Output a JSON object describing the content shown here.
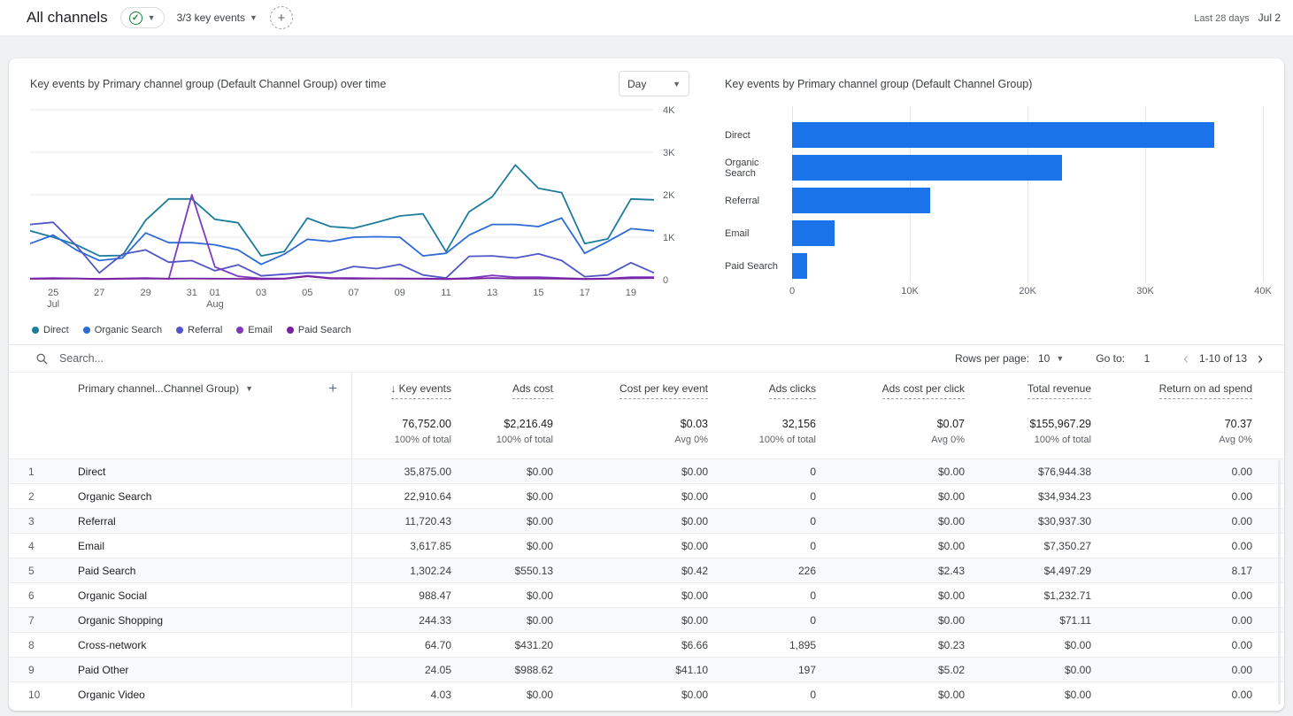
{
  "header": {
    "title": "All channels",
    "key_events_label": "3/3 key events",
    "date_range_label": "Last 28 days",
    "date_range_value": "Jul 2"
  },
  "chart_data": [
    {
      "type": "line",
      "title": "Key events by Primary channel group (Default Channel Group) over time",
      "granularity": "Day",
      "ylim": [
        0,
        4000
      ],
      "y_ticks": [
        {
          "v": 4000,
          "label": "4K"
        },
        {
          "v": 3000,
          "label": "3K"
        },
        {
          "v": 2000,
          "label": "2K"
        },
        {
          "v": 1000,
          "label": "1K"
        },
        {
          "v": 0,
          "label": "0"
        }
      ],
      "x_ticks": [
        {
          "i": 1,
          "label": "25",
          "sub": "Jul"
        },
        {
          "i": 3,
          "label": "27"
        },
        {
          "i": 5,
          "label": "29"
        },
        {
          "i": 7,
          "label": "31"
        },
        {
          "i": 8,
          "label": "01",
          "sub": "Aug"
        },
        {
          "i": 10,
          "label": "03"
        },
        {
          "i": 12,
          "label": "05"
        },
        {
          "i": 14,
          "label": "07"
        },
        {
          "i": 16,
          "label": "09"
        },
        {
          "i": 18,
          "label": "11"
        },
        {
          "i": 20,
          "label": "13"
        },
        {
          "i": 22,
          "label": "15"
        },
        {
          "i": 24,
          "label": "17"
        },
        {
          "i": 26,
          "label": "19"
        }
      ],
      "series": [
        {
          "name": "Direct",
          "color": "#1d7c9c",
          "values": [
            1150,
            1000,
            820,
            560,
            570,
            1400,
            1900,
            1900,
            1420,
            1340,
            560,
            660,
            1450,
            1250,
            1210,
            1350,
            1500,
            1550,
            660,
            1600,
            1950,
            2700,
            2150,
            2050,
            850,
            960,
            1900,
            1880
          ]
        },
        {
          "name": "Organic Search",
          "color": "#2e6bd8",
          "values": [
            850,
            1050,
            700,
            450,
            510,
            1100,
            870,
            870,
            820,
            700,
            360,
            600,
            950,
            900,
            1000,
            1010,
            1000,
            560,
            620,
            1050,
            1300,
            1300,
            1250,
            1450,
            620,
            900,
            1200,
            1150
          ]
        },
        {
          "name": "Referral",
          "color": "#5055c8",
          "values": [
            1300,
            1350,
            800,
            160,
            600,
            700,
            410,
            450,
            210,
            350,
            90,
            130,
            160,
            160,
            310,
            260,
            360,
            110,
            40,
            550,
            560,
            510,
            610,
            450,
            70,
            110,
            400,
            160
          ]
        },
        {
          "name": "Email",
          "color": "#7d3ac1",
          "values": [
            30,
            40,
            30,
            20,
            30,
            40,
            20,
            2000,
            300,
            80,
            30,
            30,
            90,
            40,
            40,
            30,
            30,
            30,
            20,
            40,
            100,
            60,
            60,
            40,
            20,
            30,
            60,
            60
          ]
        },
        {
          "name": "Paid Search",
          "color": "#7b1fa2",
          "values": [
            20,
            25,
            30,
            15,
            20,
            30,
            25,
            30,
            25,
            20,
            15,
            20,
            80,
            30,
            25,
            30,
            25,
            20,
            15,
            25,
            40,
            30,
            30,
            25,
            15,
            20,
            35,
            40
          ]
        }
      ],
      "grid": true,
      "legend_position": "bottom"
    },
    {
      "type": "bar",
      "title": "Key events by Primary channel group (Default Channel Group)",
      "categories": [
        "Direct",
        "Organic Search",
        "Referral",
        "Email",
        "Paid Search"
      ],
      "values": [
        35875,
        22911,
        11720,
        3618,
        1302
      ],
      "xlim": [
        0,
        40000
      ],
      "x_ticks": [
        "0",
        "10K",
        "20K",
        "30K",
        "40K"
      ],
      "bar_color": "#1a73e8",
      "orientation": "horizontal"
    }
  ],
  "toolbar": {
    "search_placeholder": "Search...",
    "rows_per_page_label": "Rows per page:",
    "rows_per_page_value": "10",
    "goto_label": "Go to:",
    "goto_value": "1",
    "pagination_range": "1-10 of 13"
  },
  "table": {
    "dimension_header": "Primary channel...Channel Group)",
    "columns": [
      "Key events",
      "Ads cost",
      "Cost per key event",
      "Ads clicks",
      "Ads cost per click",
      "Total revenue",
      "Return on ad spend"
    ],
    "sorted_column": "Key events",
    "totals_values": [
      "76,752.00",
      "$2,216.49",
      "$0.03",
      "32,156",
      "$0.07",
      "$155,967.29",
      "70.37"
    ],
    "totals_subs": [
      "100% of total",
      "100% of total",
      "Avg 0%",
      "100% of total",
      "Avg 0%",
      "100% of total",
      "Avg 0%"
    ],
    "rows": [
      {
        "index": "1",
        "channel": "Direct",
        "cells": [
          "35,875.00",
          "$0.00",
          "$0.00",
          "0",
          "$0.00",
          "$76,944.38",
          "0.00"
        ]
      },
      {
        "index": "2",
        "channel": "Organic Search",
        "cells": [
          "22,910.64",
          "$0.00",
          "$0.00",
          "0",
          "$0.00",
          "$34,934.23",
          "0.00"
        ]
      },
      {
        "index": "3",
        "channel": "Referral",
        "cells": [
          "11,720.43",
          "$0.00",
          "$0.00",
          "0",
          "$0.00",
          "$30,937.30",
          "0.00"
        ]
      },
      {
        "index": "4",
        "channel": "Email",
        "cells": [
          "3,617.85",
          "$0.00",
          "$0.00",
          "0",
          "$0.00",
          "$7,350.27",
          "0.00"
        ]
      },
      {
        "index": "5",
        "channel": "Paid Search",
        "cells": [
          "1,302.24",
          "$550.13",
          "$0.42",
          "226",
          "$2.43",
          "$4,497.29",
          "8.17"
        ]
      },
      {
        "index": "6",
        "channel": "Organic Social",
        "cells": [
          "988.47",
          "$0.00",
          "$0.00",
          "0",
          "$0.00",
          "$1,232.71",
          "0.00"
        ]
      },
      {
        "index": "7",
        "channel": "Organic Shopping",
        "cells": [
          "244.33",
          "$0.00",
          "$0.00",
          "0",
          "$0.00",
          "$71.11",
          "0.00"
        ]
      },
      {
        "index": "8",
        "channel": "Cross-network",
        "cells": [
          "64.70",
          "$431.20",
          "$6.66",
          "1,895",
          "$0.23",
          "$0.00",
          "0.00"
        ]
      },
      {
        "index": "9",
        "channel": "Paid Other",
        "cells": [
          "24.05",
          "$988.62",
          "$41.10",
          "197",
          "$5.02",
          "$0.00",
          "0.00"
        ]
      },
      {
        "index": "10",
        "channel": "Organic Video",
        "cells": [
          "4.03",
          "$0.00",
          "$0.00",
          "0",
          "$0.00",
          "$0.00",
          "0.00"
        ]
      }
    ]
  }
}
